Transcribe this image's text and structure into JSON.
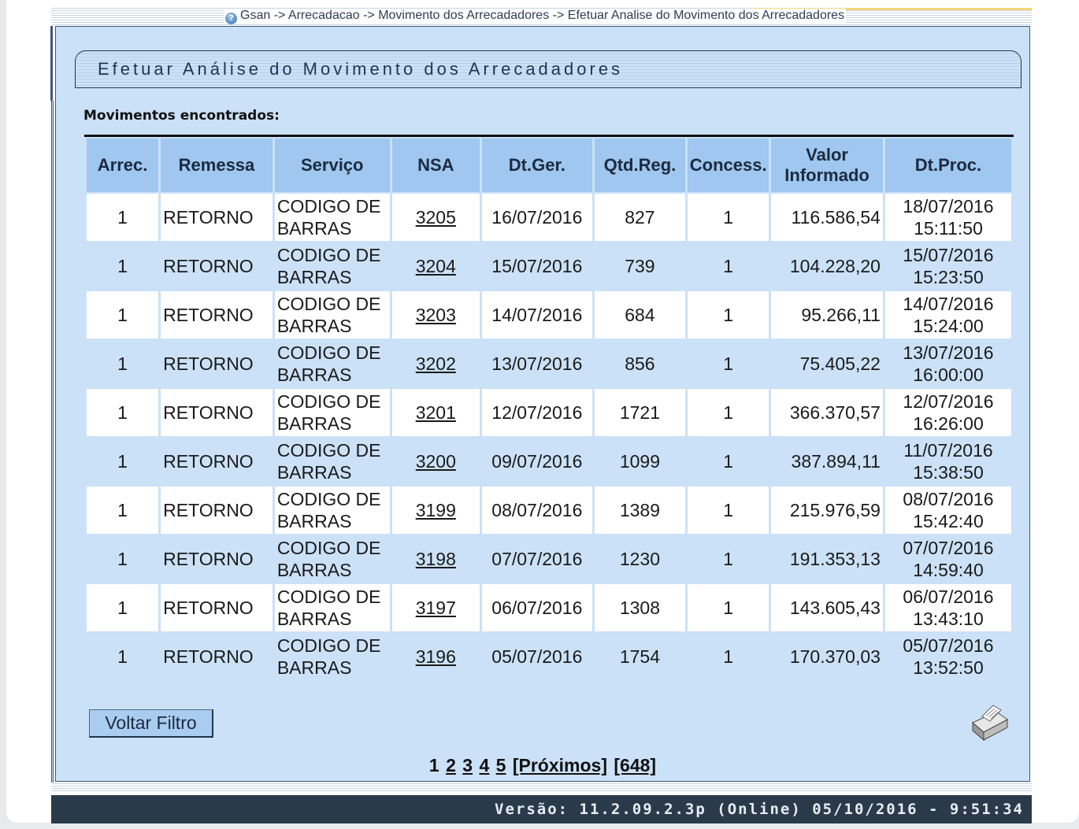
{
  "breadcrumb": "Gsan -> Arrecadacao -> Movimento dos Arrecadadores -> Efetuar Analise do Movimento dos Arrecadadores",
  "page_title": "Efetuar Análise do Movimento dos Arrecadadores",
  "section_label": "Movimentos encontrados:",
  "table": {
    "headers": {
      "arrec": "Arrec.",
      "remessa": "Remessa",
      "servico": "Serviço",
      "nsa": "NSA",
      "dtger": "Dt.Ger.",
      "qtdreg": "Qtd.Reg.",
      "concess": "Concess.",
      "valor_line1": "Valor",
      "valor_line2": "Informado",
      "dtproc": "Dt.Proc."
    },
    "rows": [
      {
        "arrec": "1",
        "remessa": "RETORNO",
        "servico_1": "CODIGO DE",
        "servico_2": "BARRAS",
        "nsa": "3205",
        "dtger": "16/07/2016",
        "qtdreg": "827",
        "concess": "1",
        "valor": "116.586,54",
        "dtproc_date": "18/07/2016",
        "dtproc_time": "15:11:50"
      },
      {
        "arrec": "1",
        "remessa": "RETORNO",
        "servico_1": "CODIGO DE",
        "servico_2": "BARRAS",
        "nsa": "3204",
        "dtger": "15/07/2016",
        "qtdreg": "739",
        "concess": "1",
        "valor": "104.228,20",
        "dtproc_date": "15/07/2016",
        "dtproc_time": "15:23:50"
      },
      {
        "arrec": "1",
        "remessa": "RETORNO",
        "servico_1": "CODIGO DE",
        "servico_2": "BARRAS",
        "nsa": "3203",
        "dtger": "14/07/2016",
        "qtdreg": "684",
        "concess": "1",
        "valor": "95.266,11",
        "dtproc_date": "14/07/2016",
        "dtproc_time": "15:24:00"
      },
      {
        "arrec": "1",
        "remessa": "RETORNO",
        "servico_1": "CODIGO DE",
        "servico_2": "BARRAS",
        "nsa": "3202",
        "dtger": "13/07/2016",
        "qtdreg": "856",
        "concess": "1",
        "valor": "75.405,22",
        "dtproc_date": "13/07/2016",
        "dtproc_time": "16:00:00"
      },
      {
        "arrec": "1",
        "remessa": "RETORNO",
        "servico_1": "CODIGO DE",
        "servico_2": "BARRAS",
        "nsa": "3201",
        "dtger": "12/07/2016",
        "qtdreg": "1721",
        "concess": "1",
        "valor": "366.370,57",
        "dtproc_date": "12/07/2016",
        "dtproc_time": "16:26:00"
      },
      {
        "arrec": "1",
        "remessa": "RETORNO",
        "servico_1": "CODIGO DE",
        "servico_2": "BARRAS",
        "nsa": "3200",
        "dtger": "09/07/2016",
        "qtdreg": "1099",
        "concess": "1",
        "valor": "387.894,11",
        "dtproc_date": "11/07/2016",
        "dtproc_time": "15:38:50"
      },
      {
        "arrec": "1",
        "remessa": "RETORNO",
        "servico_1": "CODIGO DE",
        "servico_2": "BARRAS",
        "nsa": "3199",
        "dtger": "08/07/2016",
        "qtdreg": "1389",
        "concess": "1",
        "valor": "215.976,59",
        "dtproc_date": "08/07/2016",
        "dtproc_time": "15:42:40"
      },
      {
        "arrec": "1",
        "remessa": "RETORNO",
        "servico_1": "CODIGO DE",
        "servico_2": "BARRAS",
        "nsa": "3198",
        "dtger": "07/07/2016",
        "qtdreg": "1230",
        "concess": "1",
        "valor": "191.353,13",
        "dtproc_date": "07/07/2016",
        "dtproc_time": "14:59:40"
      },
      {
        "arrec": "1",
        "remessa": "RETORNO",
        "servico_1": "CODIGO DE",
        "servico_2": "BARRAS",
        "nsa": "3197",
        "dtger": "06/07/2016",
        "qtdreg": "1308",
        "concess": "1",
        "valor": "143.605,43",
        "dtproc_date": "06/07/2016",
        "dtproc_time": "13:43:10"
      },
      {
        "arrec": "1",
        "remessa": "RETORNO",
        "servico_1": "CODIGO DE",
        "servico_2": "BARRAS",
        "nsa": "3196",
        "dtger": "05/07/2016",
        "qtdreg": "1754",
        "concess": "1",
        "valor": "170.370,03",
        "dtproc_date": "05/07/2016",
        "dtproc_time": "13:52:50"
      }
    ]
  },
  "voltar_button": "Voltar Filtro",
  "printer_icon": "printer-icon",
  "pagination": {
    "current": "1",
    "pages": [
      "2",
      "3",
      "4",
      "5"
    ],
    "next": "[Próximos]",
    "last": "[648]"
  },
  "footer": {
    "version": "Versão: 11.2.09.2.3p (Online) 05/10/2016 - 9:51:34"
  },
  "colors": {
    "panel_bg": "#cbe1f7",
    "header_bg": "#9fc7ef",
    "footer_bg": "#2b3a4a",
    "border": "#1e3550"
  }
}
